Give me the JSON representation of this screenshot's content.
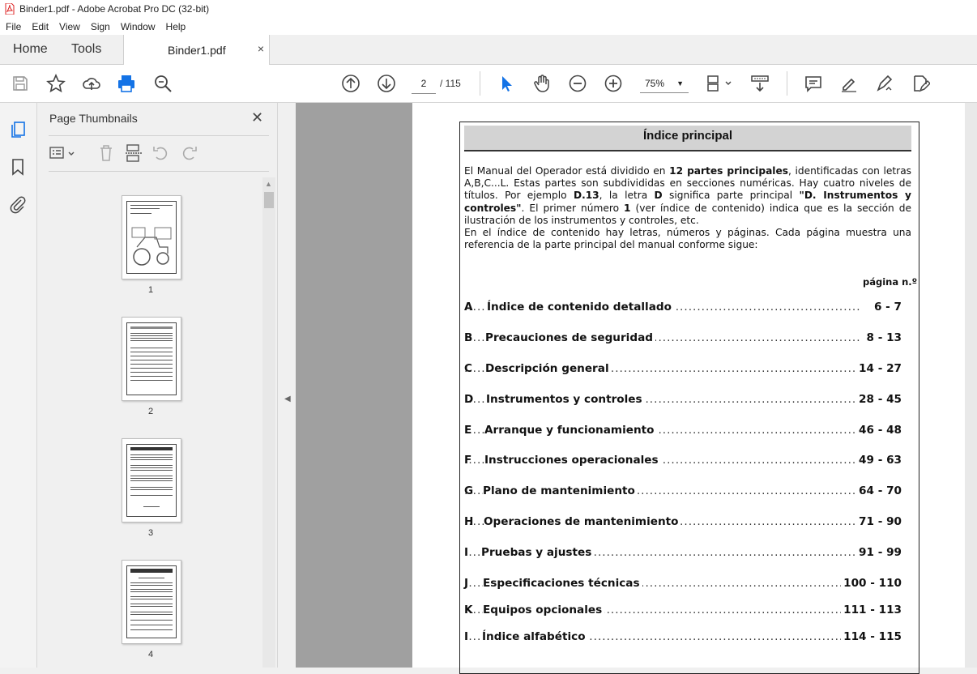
{
  "window": {
    "title": "Binder1.pdf - Adobe Acrobat Pro DC (32-bit)"
  },
  "menu": [
    "File",
    "Edit",
    "View",
    "Sign",
    "Window",
    "Help"
  ],
  "tabs": {
    "home": "Home",
    "tools": "Tools",
    "document": "Binder1.pdf",
    "close": "×"
  },
  "toolbar": {
    "page_current": "2",
    "page_total": "/ 115",
    "zoom": "75%"
  },
  "panel": {
    "title": "Page Thumbnails",
    "close": "✕",
    "thumbnails": [
      {
        "label": "1"
      },
      {
        "label": "2"
      },
      {
        "label": "3"
      },
      {
        "label": "4"
      }
    ]
  },
  "document": {
    "heading": "Índice principal",
    "intro": {
      "p1_a": "El Manual del Operador está dividido en ",
      "p1_b": "12 partes principales",
      "p1_c": ", identificadas con letras A,B,C...L. Estas partes son subdivididas en secciones numéricas. Hay cuatro niveles de títulos. Por ejemplo ",
      "p1_d": "D.13",
      "p1_e": ", la letra ",
      "p1_f": "D",
      "p1_g": " significa parte principal ",
      "p1_h": "\"D. Instrumentos y controles\"",
      "p1_i": ". El primer número ",
      "p1_j": "1",
      "p1_k": " (ver índice de contenido) indica que es la sección de ilustración de los instrumentos y controles, etc.",
      "p2": "En el índice de contenido hay letras, números y páginas. Cada página muestra una referencia de la parte principal del manual conforme sigue:"
    },
    "page_col_label": "página n.º",
    "toc": [
      {
        "letter": "A",
        "title": "Índice de contenido detallado",
        "pages": "6 - 7"
      },
      {
        "letter": "B",
        "title": "Precauciones de seguridad",
        "pages": "8 - 13"
      },
      {
        "letter": "C",
        "title": "Descripción general",
        "pages": "14 - 27"
      },
      {
        "letter": "D",
        "title": "Instrumentos y controles",
        "pages": "28 - 45"
      },
      {
        "letter": "E",
        "title": "Arranque y funcionamiento",
        "pages": "46 - 48"
      },
      {
        "letter": "F",
        "title": "Instrucciones operacionales",
        "pages": "49 - 63"
      },
      {
        "letter": "G",
        "title": "Plano de mantenimiento",
        "pages": "64 - 70"
      },
      {
        "letter": "H",
        "title": "Operaciones de mantenimiento",
        "pages": "71 - 90"
      },
      {
        "letter": "I",
        "title": "Pruebas y ajustes",
        "pages": "91 - 99"
      },
      {
        "letter": "J",
        "title": "Especificaciones técnicas",
        "pages": "100 - 110"
      },
      {
        "letter": "K",
        "title": "Equipos opcionales",
        "pages": "111 - 113"
      },
      {
        "letter": "I",
        "title": "Índice alfabético",
        "pages": "114 - 115"
      }
    ]
  }
}
